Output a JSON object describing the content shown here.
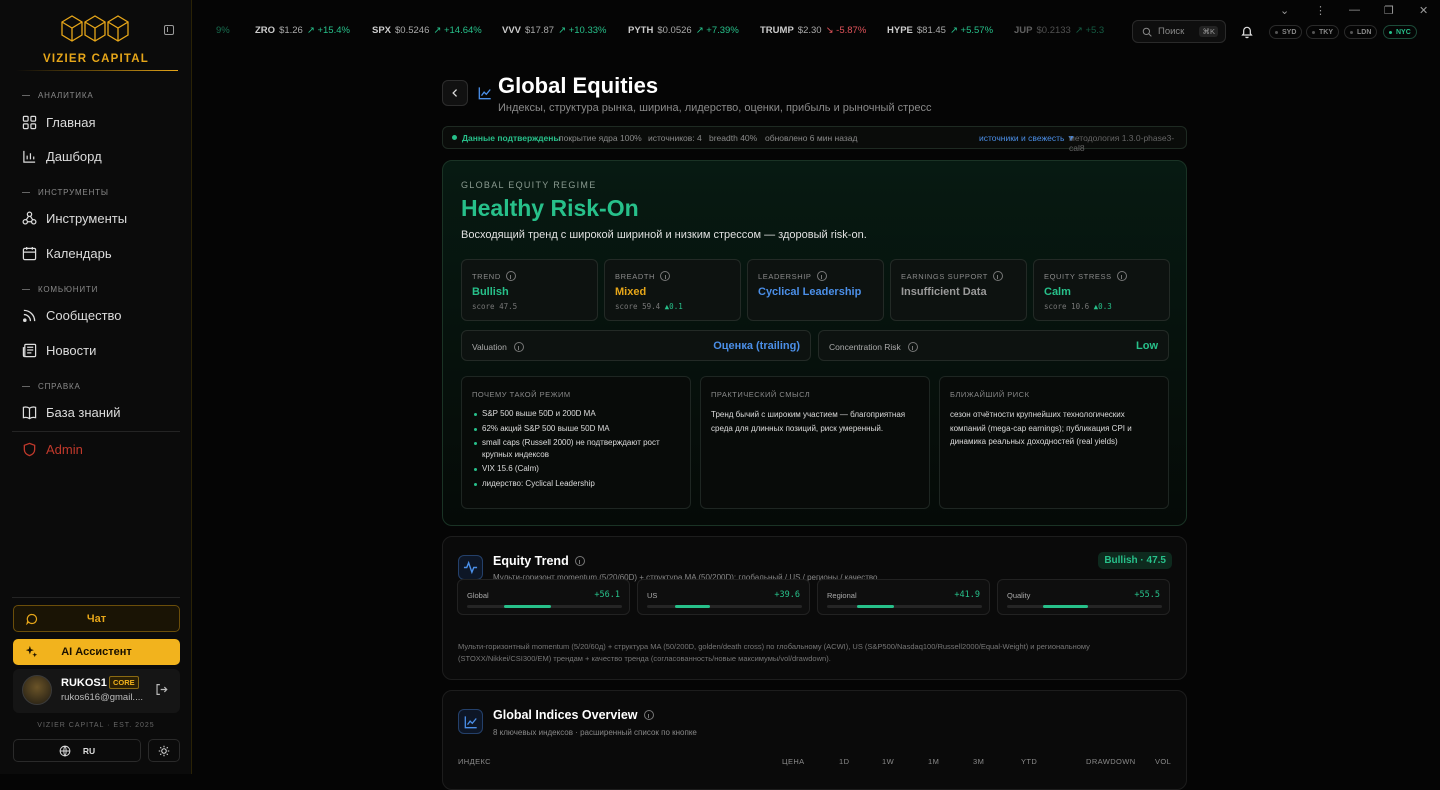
{
  "brand": {
    "name": "VIZIER CAPITAL",
    "est": "VIZIER CAPITAL · EST. 2025"
  },
  "sidebar": {
    "sections": [
      "АНАЛИТИКА",
      "ИНСТРУМЕНТЫ",
      "КОМЬЮНИТИ",
      "СПРАВКА"
    ],
    "items": [
      {
        "label": "Главная",
        "icon": "grid-icon"
      },
      {
        "label": "Дашборд",
        "icon": "bar-chart-icon"
      },
      {
        "label": "Инструменты",
        "icon": "network-icon"
      },
      {
        "label": "Календарь",
        "icon": "calendar-icon"
      },
      {
        "label": "Сообщество",
        "icon": "rss-icon"
      },
      {
        "label": "Новости",
        "icon": "newspaper-icon"
      },
      {
        "label": "База знаний",
        "icon": "book-icon"
      }
    ],
    "admin": "Admin",
    "chat": "Чат",
    "ai": "AI Ассистент",
    "user": {
      "name": "RUKOS1",
      "tier": "CORE",
      "email": "rukos616@gmail...."
    },
    "lang": "RU"
  },
  "ticker": [
    {
      "sym": "",
      "price": "",
      "chg": "9%",
      "dir": "up"
    },
    {
      "sym": "ZRO",
      "price": "$1.26",
      "chg": "+15.4%",
      "dir": "up"
    },
    {
      "sym": "SPX",
      "price": "$0.5246",
      "chg": "+14.64%",
      "dir": "up"
    },
    {
      "sym": "VVV",
      "price": "$17.87",
      "chg": "+10.33%",
      "dir": "up"
    },
    {
      "sym": "PYTH",
      "price": "$0.0526",
      "chg": "+7.39%",
      "dir": "up"
    },
    {
      "sym": "TRUMP",
      "price": "$2.30",
      "chg": "-5.87%",
      "dir": "down"
    },
    {
      "sym": "HYPE",
      "price": "$81.45",
      "chg": "+5.57%",
      "dir": "up"
    },
    {
      "sym": "JUP",
      "price": "$0.2133",
      "chg": "+5.3",
      "dir": "up"
    }
  ],
  "search": {
    "placeholder": "Поиск",
    "shortcut": "⌘K"
  },
  "timezones": [
    "SYD",
    "TKY",
    "LDN",
    "NYC"
  ],
  "page": {
    "title": "Global Equities",
    "subtitle": "Индексы, структура рынка, ширина, лидерство, оценки, прибыль и рыночный стресс"
  },
  "status": {
    "verified": "Данные подтверждены",
    "coverage": "покрытие ядра 100%",
    "sources": "источников: 4",
    "breadth": "breadth 40%",
    "updated": "обновлено 6 мин назад",
    "sources_link": "источники и свежесть ▼",
    "methodology": "методология 1.3.0-phase3-cal8"
  },
  "regime": {
    "label": "GLOBAL EQUITY REGIME",
    "title": "Healthy Risk-On",
    "desc": "Восходящий тренд с широкой шириной и низким стрессом — здоровый risk-on.",
    "metrics": [
      {
        "label": "TREND",
        "value": "Bullish",
        "score": "score 47.5",
        "delta": "",
        "color": "#27c08a"
      },
      {
        "label": "BREADTH",
        "value": "Mixed",
        "score": "score 59.4",
        "delta": "▲0.1",
        "color": "#e6a619"
      },
      {
        "label": "LEADERSHIP",
        "value": "Cyclical Leadership",
        "score": "",
        "delta": "",
        "color": "#4b8fe8"
      },
      {
        "label": "EARNINGS SUPPORT",
        "value": "Insufficient Data",
        "score": "",
        "delta": "",
        "color": "#9a9a9a"
      },
      {
        "label": "EQUITY STRESS",
        "value": "Calm",
        "score": "score 10.6",
        "delta": "▲0.3",
        "color": "#27c08a"
      }
    ],
    "valuation": {
      "label": "Valuation",
      "value": "Оценка (trailing)"
    },
    "concentration": {
      "label": "Concentration Risk",
      "value": "Low"
    },
    "why": {
      "label": "ПОЧЕМУ ТАКОЙ РЕЖИМ",
      "items": [
        "S&P 500 выше 50D и 200D MA",
        "62% акций S&P 500 выше 50D MA",
        "small caps (Russell 2000) не подтверждают рост крупных индексов",
        "VIX 15.6 (Calm)",
        "лидерство: Cyclical Leadership"
      ]
    },
    "practical": {
      "label": "ПРАКТИЧЕСКИЙ СМЫСЛ",
      "text": "Тренд бычий с широким участием — благоприятная среда для длинных позиций, риск умеренный."
    },
    "risk": {
      "label": "БЛИЖАЙШИЙ РИСК",
      "text": "сезон отчётности крупнейших технологических компаний (mega-cap earnings); публикация CPI и динамика реальных доходностей (real yields)"
    }
  },
  "trend_panel": {
    "title": "Equity Trend",
    "subtitle": "Мульти-горизонт momentum (5/20/60D) + структура MA (50/200D): глобальный / US / регионы / качество",
    "badge": "Bullish · 47.5",
    "cards": [
      {
        "label": "Global",
        "value": "+56.1",
        "fill": 0.6
      },
      {
        "label": "US",
        "value": "+39.6",
        "fill": 0.45
      },
      {
        "label": "Regional",
        "value": "+41.9",
        "fill": 0.48
      },
      {
        "label": "Quality",
        "value": "+55.5",
        "fill": 0.58
      }
    ],
    "note": "Мульти-горизонтный momentum (5/20/60д) + структура MA (50/200D, golden/death cross) по глобальному (ACWI), US (S&P500/Nasdaq100/Russell2000/Equal-Weight) и региональному (STOXX/Nikkei/CSI300/EM) трендам + качество тренда (согласованность/новые максимумы/vol/drawdown)."
  },
  "indices_panel": {
    "title": "Global Indices Overview",
    "subtitle": "8 ключевых индексов · расширенный список по кнопке",
    "columns": [
      "ИНДЕКС",
      "ЦЕНА",
      "1D",
      "1W",
      "1M",
      "3M",
      "YTD",
      "DRAWDOWN",
      "VOL"
    ]
  },
  "colors": {
    "accent": "#e6a619",
    "positive": "#27c08a",
    "negative": "#e0535a",
    "link": "#4b8fe8"
  }
}
